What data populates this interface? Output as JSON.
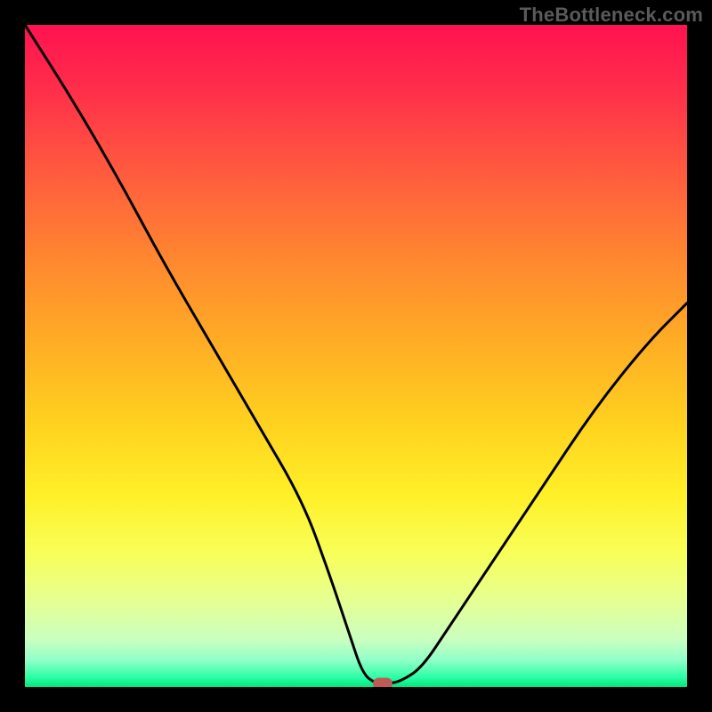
{
  "watermark": "TheBottleneck.com",
  "colors": {
    "page_bg": "#000000",
    "curve_stroke": "#000000",
    "marker_fill": "#c05a55",
    "gradient_top": "#ff1250",
    "gradient_bottom": "#00e57e"
  },
  "chart_data": {
    "type": "line",
    "title": "",
    "xlabel": "",
    "ylabel": "",
    "xlim": [
      0,
      100
    ],
    "ylim": [
      0,
      100
    ],
    "x": [
      0,
      7,
      14,
      21,
      28,
      35,
      42,
      46,
      49,
      51,
      53,
      55,
      57,
      60,
      64,
      70,
      78,
      86,
      94,
      100
    ],
    "values": [
      100,
      89,
      77,
      64,
      52,
      40,
      28,
      17,
      8,
      2,
      0.5,
      0.5,
      1,
      3,
      9,
      18,
      30,
      42,
      52,
      58
    ],
    "series": [
      {
        "name": "bottleneck_curve",
        "x": [
          0,
          7,
          14,
          21,
          28,
          35,
          42,
          46,
          49,
          51,
          53,
          55,
          57,
          60,
          64,
          70,
          78,
          86,
          94,
          100
        ],
        "values": [
          100,
          89,
          77,
          64,
          52,
          40,
          28,
          17,
          8,
          2,
          0.5,
          0.5,
          1,
          3,
          9,
          18,
          30,
          42,
          52,
          58
        ]
      }
    ],
    "marker": {
      "x": 54,
      "y": 0.5
    },
    "background_gradient": {
      "direction": "vertical",
      "stops": [
        {
          "pos": 0.0,
          "color": "#ff1250"
        },
        {
          "pos": 0.35,
          "color": "#ff8630"
        },
        {
          "pos": 0.6,
          "color": "#ffd11f"
        },
        {
          "pos": 0.8,
          "color": "#f8ff5a"
        },
        {
          "pos": 0.93,
          "color": "#c8ffc0"
        },
        {
          "pos": 1.0,
          "color": "#00e57e"
        }
      ]
    }
  }
}
